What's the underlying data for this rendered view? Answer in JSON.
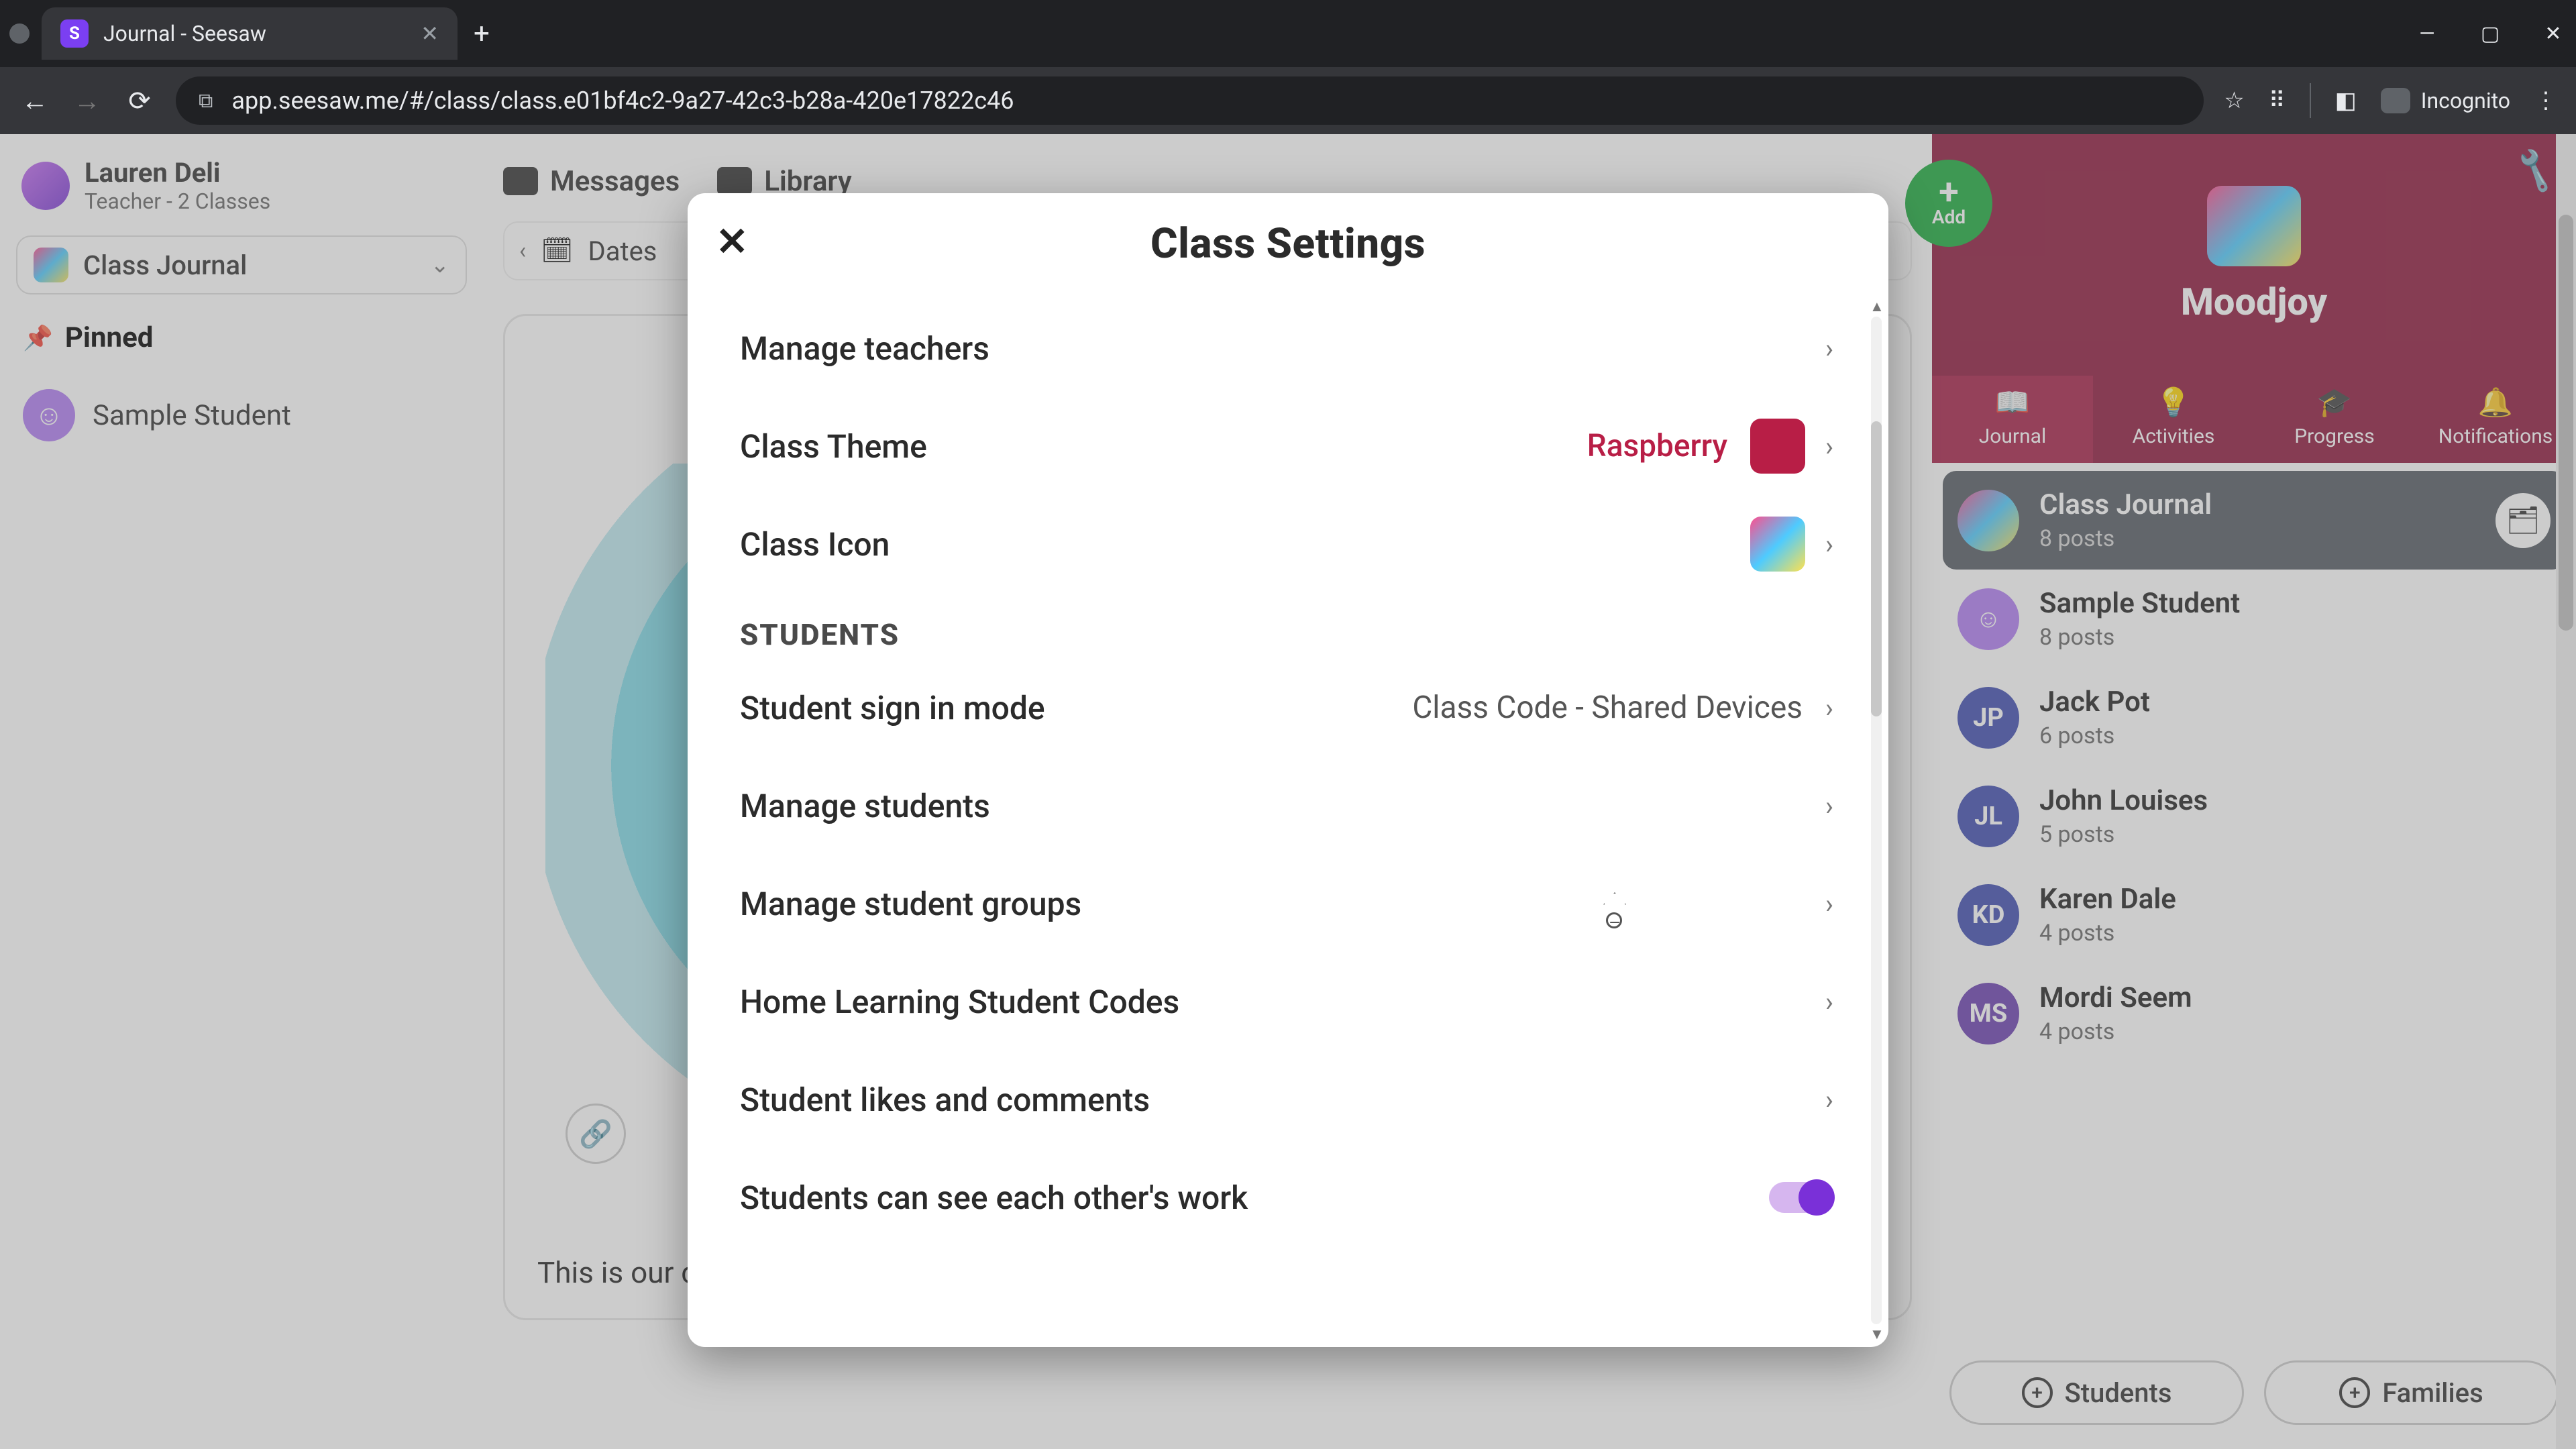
{
  "browser": {
    "tab_title": "Journal - Seesaw",
    "tab_favicon_letter": "S",
    "url": "app.seesaw.me/#/class/class.e01bf4c2-9a27-42c3-b28a-420e17822c46",
    "incognito_label": "Incognito"
  },
  "profile": {
    "name": "Lauren Deli",
    "role": "Teacher - 2 Classes"
  },
  "topnav": {
    "messages": "Messages",
    "library": "Library"
  },
  "class_selector": {
    "label": "Class Journal"
  },
  "dates_label": "Dates",
  "pinned_label": "Pinned",
  "left_student": {
    "name": "Sample Student"
  },
  "feed": {
    "caption": "This is our class!"
  },
  "add_button": {
    "label": "Add",
    "plus": "+"
  },
  "class_banner": {
    "title": "Moodjoy"
  },
  "right_tabs": {
    "journal": "Journal",
    "activities": "Activities",
    "progress": "Progress",
    "notifications": "Notifications"
  },
  "right_list": [
    {
      "name": "Class Journal",
      "sub": "8 posts",
      "selected": true,
      "avatar_type": "icon"
    },
    {
      "name": "Sample Student",
      "sub": "8 posts",
      "avatar_bg": "#b07df3",
      "initials": ""
    },
    {
      "name": "Jack Pot",
      "sub": "6 posts",
      "avatar_bg": "#3f4db0",
      "initials": "JP"
    },
    {
      "name": "John Louises",
      "sub": "5 posts",
      "avatar_bg": "#3f4db0",
      "initials": "JL"
    },
    {
      "name": "Karen Dale",
      "sub": "4 posts",
      "avatar_bg": "#3f4db0",
      "initials": "KD"
    },
    {
      "name": "Mordi Seem",
      "sub": "4 posts",
      "avatar_bg": "#6b3fb0",
      "initials": "MS"
    }
  ],
  "bottom_buttons": {
    "students": "Students",
    "families": "Families"
  },
  "modal": {
    "title": "Class Settings",
    "rows": {
      "manage_teachers": "Manage teachers",
      "class_theme": "Class Theme",
      "class_theme_value": "Raspberry",
      "class_icon": "Class Icon",
      "students_header": "STUDENTS",
      "signin_mode": "Student sign in mode",
      "signin_mode_value": "Class Code - Shared Devices",
      "manage_students": "Manage students",
      "manage_groups": "Manage student groups",
      "home_codes": "Home Learning Student Codes",
      "likes_comments": "Student likes and comments",
      "see_each_other": "Students can see each other's work"
    }
  },
  "colors": {
    "raspberry": "#b81e46",
    "banner": "#8e183d",
    "add_green": "#1aab3c",
    "toggle_on": "#7a30d8"
  }
}
